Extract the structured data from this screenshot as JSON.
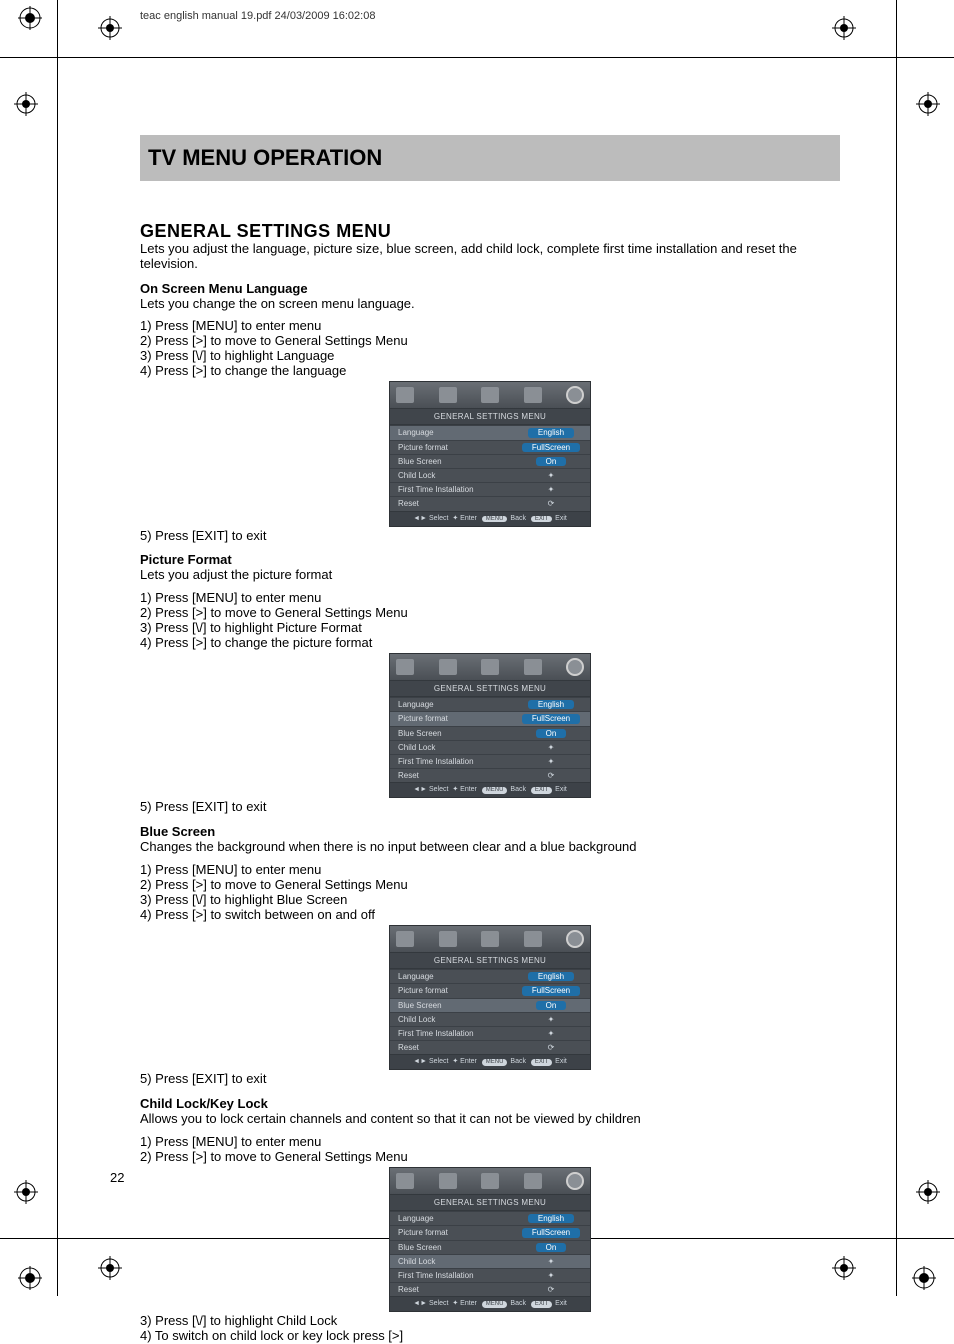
{
  "meta": {
    "header": "teac english manual 19.pdf   24/03/2009   16:02:08"
  },
  "page_number": "22",
  "title": "TV MENU OPERATION",
  "section_heading": "GENERAL SETTINGS MENU",
  "section_lead": "Lets you adjust the language, picture size, blue screen, add child lock, complete first time installation and reset the television.",
  "osd": {
    "title": "GENERAL SETTINGS MENU",
    "rows": [
      {
        "label": "Language",
        "value": "English",
        "pill": true
      },
      {
        "label": "Picture format",
        "value": "FullScreen",
        "pill": true
      },
      {
        "label": "Blue Screen",
        "value": "On",
        "pill": true
      },
      {
        "label": "Child Lock",
        "value": "✦"
      },
      {
        "label": "First Time Installation",
        "value": "✦"
      },
      {
        "label": "Reset",
        "value": "⟳"
      }
    ],
    "footer_select": "Select",
    "footer_enter": "Enter",
    "footer_back_btn": "MENU",
    "footer_back": "Back",
    "footer_exit_btn": "EXIT",
    "footer_exit": "Exit"
  },
  "subsections": [
    {
      "id": "lang",
      "heading": "On Screen Menu Language",
      "lead": "Lets you change the on screen menu language.",
      "steps_pre": [
        "1) Press [MENU] to enter menu",
        "2) Press [>] to move to General Settings Menu",
        "3) Press [\\/] to highlight Language",
        "4) Press [>] to change the language"
      ],
      "steps_post": [
        "5) Press [EXIT] to exit"
      ],
      "highlight": 0
    },
    {
      "id": "picfmt",
      "heading": "Picture Format",
      "lead": "Lets you adjust the picture format",
      "steps_pre": [
        "1) Press [MENU] to enter menu",
        "2) Press [>] to move to General Settings Menu",
        "3) Press [\\/] to highlight Picture Format",
        "4) Press [>] to change the picture format"
      ],
      "steps_post": [
        "5) Press [EXIT] to exit"
      ],
      "highlight": 1
    },
    {
      "id": "bluescreen",
      "heading": "Blue Screen",
      "lead": "Changes the background when there is no input between clear and a blue background",
      "steps_pre": [
        "1) Press [MENU] to enter menu",
        "2) Press [>] to move to General Settings Menu",
        "3) Press [\\/] to highlight Blue Screen",
        "4) Press [>] to switch between on and off"
      ],
      "steps_post": [
        "5) Press [EXIT] to exit"
      ],
      "highlight": 2
    },
    {
      "id": "childlock",
      "heading": "Child Lock/Key Lock",
      "lead": "Allows you to lock certain channels and content so that it can not be viewed by children",
      "steps_pre": [
        "1) Press [MENU] to enter menu",
        "2) Press [>] to move to General Settings Menu"
      ],
      "steps_post": [
        "3) Press [\\/] to highlight Child Lock",
        "4) To switch on child lock or key lock press [>]"
      ],
      "highlight": 3
    }
  ]
}
